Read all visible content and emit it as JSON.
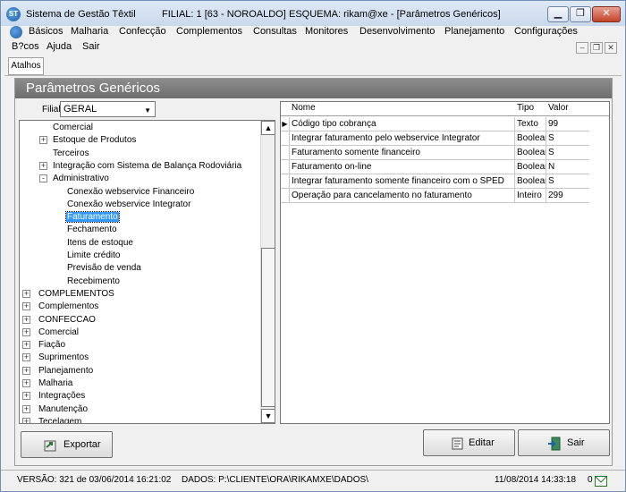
{
  "window": {
    "app_name": "Sistema de Gestão Têxtil",
    "filial": "FILIAL: 1 [63 - NOROALDO]",
    "esquema": "ESQUEMA: rikam@xe - [Parâmetros Genéricos]",
    "minimize": "▁",
    "maximize": "❐",
    "close": "✕"
  },
  "menu": {
    "row1": [
      "Básicos",
      "Malharia",
      "Confecção",
      "Complementos",
      "Consultas",
      "Monitores",
      "Desenvolvimento",
      "Planejamento",
      "Configurações"
    ],
    "row2": [
      "B?cos",
      "Ajuda",
      "Sair"
    ],
    "mdi": [
      "–",
      "❐",
      "✕"
    ]
  },
  "toolbar": {
    "atalhos": "Atalhos"
  },
  "form": {
    "title": "Parâmetros Genéricos",
    "filial_label": "Filial",
    "filial_value": "GERAL"
  },
  "tree": {
    "items": [
      {
        "label": "Comercial",
        "level": 2,
        "expander": "",
        "selected": false
      },
      {
        "label": "Estoque de Produtos",
        "level": 2,
        "expander": "+",
        "selected": false
      },
      {
        "label": "Terceiros",
        "level": 2,
        "expander": "",
        "selected": false
      },
      {
        "label": "Integração com Sistema de Balança Rodoviária",
        "level": 2,
        "expander": "+",
        "selected": false
      },
      {
        "label": "Administrativo",
        "level": 2,
        "expander": "-",
        "selected": false
      },
      {
        "label": "Conexão webservice Financeiro",
        "level": 3,
        "expander": "",
        "selected": false
      },
      {
        "label": "Conexão webservice Integrator",
        "level": 3,
        "expander": "",
        "selected": false
      },
      {
        "label": "Faturamento",
        "level": 3,
        "expander": "",
        "selected": true
      },
      {
        "label": "Fechamento",
        "level": 3,
        "expander": "",
        "selected": false
      },
      {
        "label": "Itens de estoque",
        "level": 3,
        "expander": "",
        "selected": false
      },
      {
        "label": "Limite crédito",
        "level": 3,
        "expander": "",
        "selected": false
      },
      {
        "label": "Previsão de venda",
        "level": 3,
        "expander": "",
        "selected": false
      },
      {
        "label": "Recebimento",
        "level": 3,
        "expander": "",
        "selected": false
      },
      {
        "label": "COMPLEMENTOS",
        "level": 1,
        "expander": "+",
        "selected": false
      },
      {
        "label": "Complementos",
        "level": 1,
        "expander": "+",
        "selected": false
      },
      {
        "label": "CONFECCAO",
        "level": 1,
        "expander": "+",
        "selected": false
      },
      {
        "label": "Comercial",
        "level": 1,
        "expander": "+",
        "selected": false
      },
      {
        "label": "Fiação",
        "level": 1,
        "expander": "+",
        "selected": false
      },
      {
        "label": "Suprimentos",
        "level": 1,
        "expander": "+",
        "selected": false
      },
      {
        "label": "Planejamento",
        "level": 1,
        "expander": "+",
        "selected": false
      },
      {
        "label": "Malharia",
        "level": 1,
        "expander": "+",
        "selected": false
      },
      {
        "label": "Integrações",
        "level": 1,
        "expander": "+",
        "selected": false
      },
      {
        "label": "Manutenção",
        "level": 1,
        "expander": "+",
        "selected": false
      },
      {
        "label": "Tecelagem",
        "level": 1,
        "expander": "+",
        "selected": false
      }
    ],
    "scroll_up": "▲",
    "scroll_down": "▼"
  },
  "grid": {
    "columns": [
      "Nome",
      "Tipo",
      "Valor"
    ],
    "current_marker": "▶",
    "rows": [
      {
        "nome": "Código tipo cobrança",
        "tipo": "Texto",
        "valor": "99"
      },
      {
        "nome": "Integrar faturamento pelo webservice Integrator",
        "tipo": "Boolean",
        "valor": "S"
      },
      {
        "nome": "Faturamento somente financeiro",
        "tipo": "Boolean",
        "valor": "S"
      },
      {
        "nome": "Faturamento on-line",
        "tipo": "Boolean",
        "valor": "N"
      },
      {
        "nome": "Integrar faturamento somente financeiro com o SPED",
        "tipo": "Boolean",
        "valor": "S"
      },
      {
        "nome": "Operação para cancelamento no faturamento",
        "tipo": "Inteiro",
        "valor": "299"
      }
    ]
  },
  "buttons": {
    "exportar": "Exportar",
    "editar": "Editar",
    "sair": "Sair"
  },
  "status": {
    "versao": "VERSÃO: 321 de 03/06/2014 16:21:02",
    "dados": "DADOS: P:\\CLIENTE\\ORA\\RIKAMXE\\DADOS\\",
    "datetime": "11/08/2014 14:33:18",
    "msg_count": "0"
  },
  "colors": {
    "selection": "#3399ff",
    "header": "#7a7a7a"
  }
}
